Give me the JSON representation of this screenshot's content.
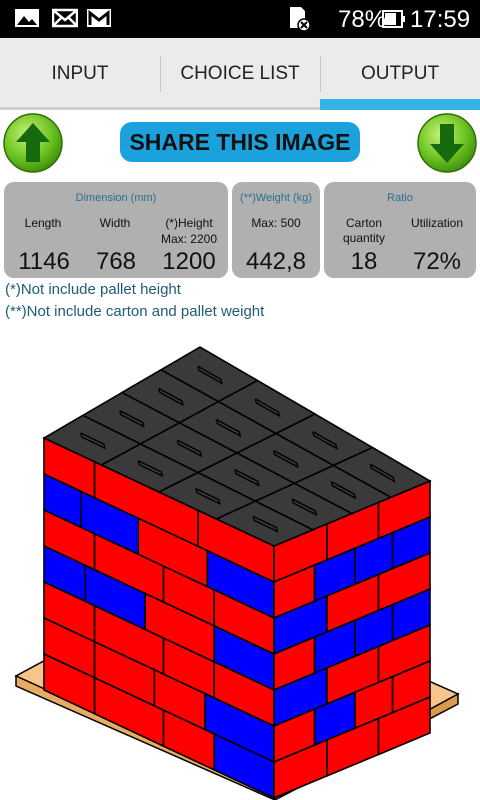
{
  "status_bar": {
    "icons": [
      "picture-icon",
      "mail-icon",
      "gmail-icon",
      "sd-card-icon",
      "battery-icon"
    ],
    "battery": "78%",
    "time": "17:59"
  },
  "tabs": [
    {
      "label": "INPUT"
    },
    {
      "label": "CHOICE LIST"
    },
    {
      "label": "OUTPUT",
      "selected": true
    }
  ],
  "actions": {
    "share_label": "SHARE THIS IMAGE",
    "up_icon": "arrow-up-icon",
    "down_icon": "arrow-down-icon"
  },
  "dimension": {
    "title": "Dimension (mm)",
    "length_label": "Length",
    "width_label": "Width",
    "height_label": "(*)Height",
    "height_max": "Max: 2200",
    "length": "1146",
    "width": "768",
    "height": "1200"
  },
  "weight": {
    "title": "(**)Weight (kg)",
    "max": "Max: 500",
    "value": "442,8"
  },
  "ratio": {
    "title": "Ratio",
    "carton_label": "Carton quantity",
    "utilization_label": "Utilization",
    "carton_quantity": "18",
    "utilization": "72%"
  },
  "notes": {
    "note1": "(*)Not include pallet height",
    "note2": "(**)Not include carton and pallet weight"
  },
  "colors": {
    "accent": "#33b5e5",
    "share_button": "#1ba1dc",
    "panel": "#b0b0b0",
    "carton_red": "#ff0000",
    "carton_blue": "#0000ff",
    "top_layer": "#3a3a3a",
    "pallet": "#f7c48a"
  }
}
